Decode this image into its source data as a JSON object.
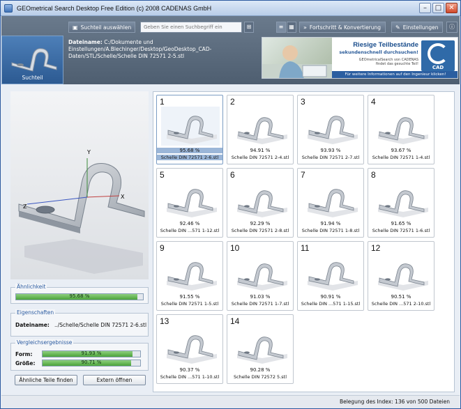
{
  "window": {
    "title": "GEOmetrical Search Desktop Free Edition (c) 2008 CADENAS GmbH"
  },
  "toolbar": {
    "select_part_label": "Suchteil auswählen",
    "search_placeholder": "Geben Sie einen Suchbegriff ein",
    "progress_label": "Fortschritt & Konvertierung",
    "settings_label": "Einstellungen"
  },
  "header": {
    "thumb_label": "Suchteil",
    "filename_label": "Dateiname:",
    "filename_value": "C:/Dokumente und Einstellungen/A.Blechinger/Desktop/GeoDesktop_CAD-Daten/STL/Schelle/Schelle DIN 72571 2-5.stl"
  },
  "banner": {
    "headline": "Riesige Teilbestände",
    "subline": "sekundenschnell durchsuchen!",
    "small1": "GEOmetricalSearch von CADENAS",
    "small2": "findet das gesuchte Teil!",
    "footer": "Für weitere Informationen auf den Ingenieur klicken!",
    "logo_text": "CAD"
  },
  "left": {
    "similarity_title": "Ähnlichkeit",
    "similarity_value": "95.68 %",
    "similarity_fraction": 0.9568,
    "properties_title": "Eigenschaften",
    "filename_label": "Dateiname:",
    "filename_value": "../Schelle/Schelle DIN 72571 2-6.stl",
    "compare_title": "Vergleichsergebnisse",
    "form_label": "Form:",
    "form_value": "91.93 %",
    "form_fraction": 0.9193,
    "size_label": "Größe:",
    "size_value": "90.71 %",
    "size_fraction": 0.9071,
    "similar_btn": "Ähnliche Teile finden",
    "external_btn": "Extern öffnen",
    "axis_y": "Y",
    "axis_x": "X",
    "axis_z": "Z"
  },
  "results": [
    {
      "num": "1",
      "pct": "95.68 %",
      "name": "Schelle DIN 72571 2-6.stl",
      "selected": true
    },
    {
      "num": "2",
      "pct": "94.91 %",
      "name": "Schelle DIN 72571 2-4.stl"
    },
    {
      "num": "3",
      "pct": "93.93 %",
      "name": "Schelle DIN 72571 2-7.stl"
    },
    {
      "num": "4",
      "pct": "93.67 %",
      "name": "Schelle DIN 72571 1-4.stl"
    },
    {
      "num": "5",
      "pct": "92.46 %",
      "name": "Schelle DIN ...571 1-12.stl"
    },
    {
      "num": "6",
      "pct": "92.29 %",
      "name": "Schelle DIN 72571 2-8.stl"
    },
    {
      "num": "7",
      "pct": "91.94 %",
      "name": "Schelle DIN 72571 1-8.stl"
    },
    {
      "num": "8",
      "pct": "91.65 %",
      "name": "Schelle DIN 72571 1-6.stl"
    },
    {
      "num": "9",
      "pct": "91.55 %",
      "name": "Schelle DIN 72571 1-5.stl"
    },
    {
      "num": "10",
      "pct": "91.03 %",
      "name": "Schelle DIN 72571 1-7.stl"
    },
    {
      "num": "11",
      "pct": "90.91 %",
      "name": "Schelle DIN ...571 1-15.stl"
    },
    {
      "num": "12",
      "pct": "90.51 %",
      "name": "Schelle DIN ...571 2-10.stl"
    },
    {
      "num": "13",
      "pct": "90.37 %",
      "name": "Schelle DIN ...571 1-10.stl"
    },
    {
      "num": "14",
      "pct": "90.28 %",
      "name": "Schelle DIN 72572 5.stl"
    }
  ],
  "status": {
    "text": "Belegung des Index: 136 von 500 Dateien"
  },
  "colors": {
    "accent": "#2c5aa0",
    "header": "#5a6a7c",
    "bar": "#4ba33a"
  }
}
